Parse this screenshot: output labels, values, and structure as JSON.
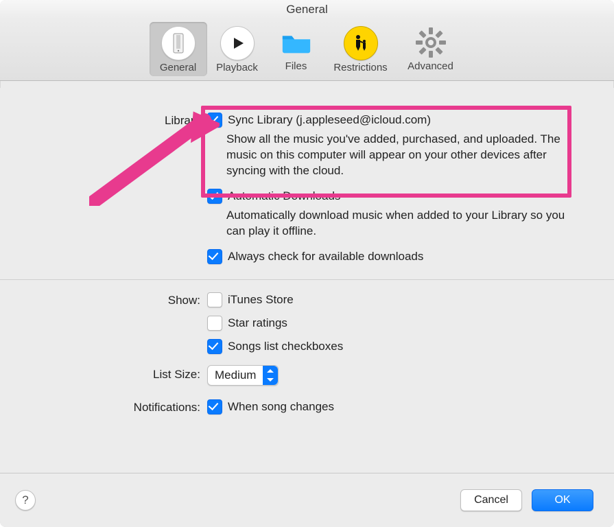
{
  "window": {
    "title": "General"
  },
  "toolbar": {
    "tabs": [
      {
        "label": "General",
        "selected": true
      },
      {
        "label": "Playback",
        "selected": false
      },
      {
        "label": "Files",
        "selected": false
      },
      {
        "label": "Restrictions",
        "selected": false
      },
      {
        "label": "Advanced",
        "selected": false
      }
    ]
  },
  "sections": {
    "library": {
      "label": "Library",
      "sync": {
        "label": "Sync Library (j.appleseed@icloud.com)",
        "checked": true,
        "desc": "Show all the music you've added, purchased, and uploaded. The music on this computer will appear on your other devices after syncing with the cloud."
      },
      "autodl": {
        "label": "Automatic Downloads",
        "checked": true,
        "desc": "Automatically download music when added to your Library so you can play it offline."
      },
      "alwayscheck": {
        "label": "Always check for available downloads",
        "checked": true
      }
    },
    "show": {
      "label": "Show:",
      "itunes": {
        "label": "iTunes Store",
        "checked": false
      },
      "stars": {
        "label": "Star ratings",
        "checked": false
      },
      "songchk": {
        "label": "Songs list checkboxes",
        "checked": true
      }
    },
    "listsize": {
      "label": "List Size:",
      "value": "Medium"
    },
    "notifications": {
      "label": "Notifications:",
      "songchange": {
        "label": "When song changes",
        "checked": true
      }
    }
  },
  "buttons": {
    "help": "?",
    "cancel": "Cancel",
    "ok": "OK"
  },
  "annotation": {
    "arrow_color": "#e83a8e"
  }
}
